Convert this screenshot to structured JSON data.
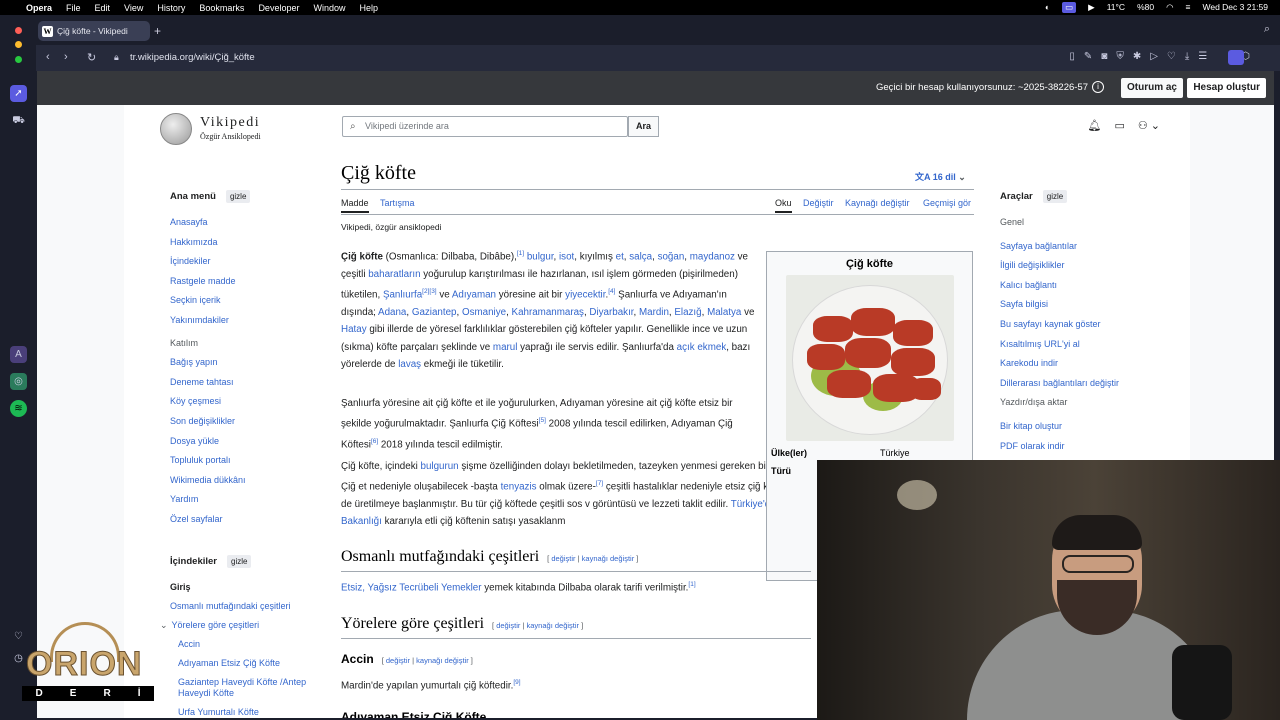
{
  "menubar": {
    "items": [
      "Opera",
      "File",
      "Edit",
      "View",
      "History",
      "Bookmarks",
      "Developer",
      "Window",
      "Help"
    ],
    "weather": "11°C",
    "battery": "%80",
    "datetime": "Wed Dec 3  21:59"
  },
  "browser": {
    "tab_title": "Çiğ köfte - Vikipedi",
    "favicon": "W",
    "url": "tr.wikipedia.org/wiki/Çiğ_köfte",
    "accent_color": "#5b5be0"
  },
  "notice": {
    "text": "Geçici bir hesap kullanıyorsunuz: ~2025-38226-57",
    "login": "Oturum aç",
    "create": "Hesap oluştur"
  },
  "header": {
    "wordmark": "Vikipedi",
    "tagline": "Özgür Ansiklopedi",
    "search_placeholder": "Vikipedi üzerinde ara",
    "search_button": "Ara"
  },
  "main_menu": {
    "title": "Ana menü",
    "hide": "gizle",
    "items": [
      "Anasayfa",
      "Hakkımızda",
      "İçindekiler",
      "Rastgele madde",
      "Seçkin içerik",
      "Yakınımdakiler"
    ],
    "section": "Katılım",
    "items2": [
      "Bağış yapın",
      "Deneme tahtası",
      "Köy çeşmesi",
      "Son değişiklikler",
      "Dosya yükle",
      "Topluluk portalı",
      "Wikimedia dükkânı",
      "Yardım",
      "Özel sayfalar"
    ]
  },
  "toc": {
    "title": "İçindekiler",
    "hide": "gizle",
    "items": [
      "Giriş",
      "Osmanlı mutfağındaki çeşitleri",
      "Yörelere göre çeşitleri",
      "Accin",
      "Adıyaman Etsiz Çiğ Köfte",
      "Gaziantep Haveydi Köfte /Antep Haveydi Köfte",
      "Urfa Yumurtalı Köfte"
    ]
  },
  "article": {
    "title": "Çiğ köfte",
    "languages": "16 dil",
    "tabs": [
      "Madde",
      "Tartışma"
    ],
    "actions": [
      "Oku",
      "Değiştir",
      "Kaynağı değiştir",
      "Geçmişi gör"
    ],
    "from": "Vikipedi, özgür ansiklopedi",
    "p1": {
      "t1": "Çiğ köfte",
      "t2": " (Osmanlıca: Dilbaba, Dibâbe),",
      "s1": "[1]",
      "l1": "bulgur",
      "l2": "isot",
      "t3": ", kıyılmış ",
      "l3": "et",
      "l4": "salça",
      "l5": "soğan",
      "l6": "maydanoz",
      "t4": " ve çeşitli ",
      "l7": "baharatların",
      "t5": " yoğurulup karıştırılması ile hazırlanan, ısıl işlem görmeden (pişirilmeden) tüketilen, ",
      "l8": "Şanlıurfa",
      "s2": "[2][3]",
      "t6": " ve ",
      "l9": "Adıyaman",
      "t7": " yöresine ait bir ",
      "l10": "yiyecektir",
      "s3": "[4]",
      "t8": " Şanlıurfa ve Adıyaman'ın dışında; ",
      "l11": "Adana",
      "l12": "Gaziantep",
      "l13": "Osmaniye",
      "l14": "Kahramanmaraş",
      "l15": "Diyarbakır",
      "l16": "Mardin",
      "l17": "Elazığ",
      "l18": "Malatya",
      "l19": "Hatay",
      "t9": " gibi illerde de yöresel farklılıklar gösterebilen çiğ köfteler yapılır. Genellikle ince ve uzun (sıkma) köfte parçaları şeklinde ve ",
      "l20": "marul",
      "t10": " yaprağı ile servis edilir. Şanlıurfa'da ",
      "l21": "açık ekmek",
      "t11": ", bazı yörelerde de ",
      "l22": "lavaş",
      "t12": " ekmeği ile tüketilir."
    },
    "p2": {
      "t1": "Şanlıurfa yöresine ait çiğ köfte et ile yoğurulurken, Adıyaman yöresine ait çiğ köfte etsiz bir şekilde yoğurulmaktadır. Şanlıurfa Çiğ Köftesi",
      "s1": "[5]",
      "t2": " 2008 yılında tescil edilirken, Adıyaman Çiğ Köftesi",
      "s2": "[6]",
      "t3": " 2018 yılında tescil edilmiştir."
    },
    "p3": {
      "t1": "Çiğ köfte, içindeki ",
      "l1": "bulgurun",
      "t2": " şişme özelliğinden dolayı bekletilmeden, tazeyken yenmesi gereken bir ",
      "l2": "besindir",
      "t3": ". Çiğ et nedeniyle oluşabilecek -başta ",
      "l3": "tenyazis",
      "t4": " olmak üzere-",
      "s1": "[7]",
      "t5": " çeşitli hastalıklar nedeniyle etsiz çiğ köfte çeşitleri de üretilmeye başlanmıştır. Bu tür çiğ köftede çeşitli sos v",
      "t6": "görüntüsü ve lezzeti taklit edilir. ",
      "l4": "Türkiye'de Sağlık Bakanlığı",
      "t7": " kararıyla etli çiğ köftenin satışı yasaklanm"
    },
    "h2a": "Osmanlı mutfağındaki çeşitleri",
    "edit_a": "değiştir",
    "edit_sep": " | ",
    "edit_b": "kaynağı değiştir",
    "p4": {
      "l1": "Etsiz, Yağsız Tecrübeli Yemekler",
      "t1": " yemek kitabında Dilbaba olarak tarifi verilmiştir.",
      "s1": "[1]"
    },
    "h2b": "Yörelere göre çeşitleri",
    "h3a": "Accin",
    "p5": {
      "t1": "Mardin'de yapılan yumurtalı çiğ köftedir.",
      "s1": "[9]"
    },
    "h3b": "Adıyaman Etsiz Çiğ Köfte"
  },
  "infobox": {
    "title": "Çiğ köfte",
    "rows": [
      {
        "label": "Ülke(ler)",
        "value": "Türkiye"
      },
      {
        "label": "Türü",
        "value": ""
      }
    ]
  },
  "tools": {
    "title": "Araçlar",
    "hide": "gizle",
    "section1": "Genel",
    "items1": [
      "Sayfaya bağlantılar",
      "İlgili değişiklikler",
      "Kalıcı bağlantı",
      "Sayfa bilgisi",
      "Bu sayfayı kaynak göster",
      "Kısaltılmış URL'yi al",
      "Karekodu indir",
      "Dillerarası bağlantıları değiştir"
    ],
    "section2": "Yazdır/dışa aktar",
    "items2": [
      "Bir kitap oluştur",
      "PDF olarak indir"
    ]
  },
  "watermark": {
    "brand": "ORION",
    "letters": [
      "D",
      "E",
      "R",
      "İ"
    ]
  }
}
